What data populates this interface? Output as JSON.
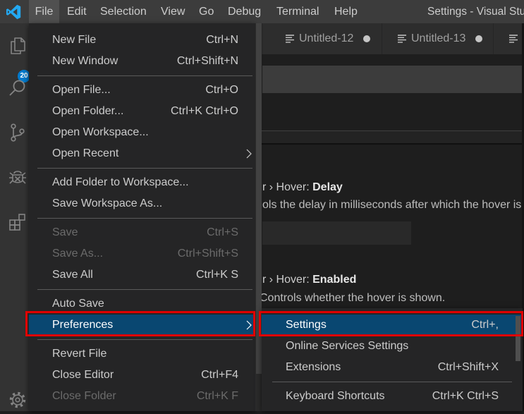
{
  "window": {
    "title": "Settings - Visual Stu"
  },
  "menubar": {
    "items": [
      {
        "label": "File",
        "active": true
      },
      {
        "label": "Edit"
      },
      {
        "label": "Selection"
      },
      {
        "label": "View"
      },
      {
        "label": "Go"
      },
      {
        "label": "Debug"
      },
      {
        "label": "Terminal"
      },
      {
        "label": "Help"
      }
    ]
  },
  "activity_bar": {
    "items": [
      {
        "icon": "files-icon",
        "badge": "20"
      },
      {
        "icon": "search-icon"
      },
      {
        "icon": "source-control-icon"
      },
      {
        "icon": "debug-icon"
      },
      {
        "icon": "extensions-icon"
      }
    ],
    "bottom": [
      {
        "icon": "gear-icon"
      }
    ]
  },
  "tabs": [
    {
      "label": "Untitled-12",
      "dirty": true
    },
    {
      "label": "Untitled-13",
      "dirty": true
    },
    {
      "label": "",
      "dirty": false
    }
  ],
  "settings": {
    "items": [
      {
        "prefix": "r › Hover: ",
        "name": "Delay",
        "description": "ols the delay in milliseconds after which the hover is",
        "value": ""
      },
      {
        "prefix": "r › Hover: ",
        "name": "Enabled",
        "description": "Controls whether the hover is shown."
      }
    ]
  },
  "file_menu": {
    "groups": [
      [
        {
          "label": "New File",
          "shortcut": "Ctrl+N"
        },
        {
          "label": "New Window",
          "shortcut": "Ctrl+Shift+N"
        }
      ],
      [
        {
          "label": "Open File...",
          "shortcut": "Ctrl+O"
        },
        {
          "label": "Open Folder...",
          "shortcut": "Ctrl+K Ctrl+O"
        },
        {
          "label": "Open Workspace...",
          "shortcut": ""
        },
        {
          "label": "Open Recent",
          "shortcut": "",
          "submenu": true
        }
      ],
      [
        {
          "label": "Add Folder to Workspace...",
          "shortcut": ""
        },
        {
          "label": "Save Workspace As...",
          "shortcut": ""
        }
      ],
      [
        {
          "label": "Save",
          "shortcut": "Ctrl+S",
          "disabled": true
        },
        {
          "label": "Save As...",
          "shortcut": "Ctrl+Shift+S",
          "disabled": true
        },
        {
          "label": "Save All",
          "shortcut": "Ctrl+K S"
        }
      ],
      [
        {
          "label": "Auto Save",
          "shortcut": ""
        },
        {
          "label": "Preferences",
          "shortcut": "",
          "submenu": true,
          "highlighted": true
        }
      ],
      [
        {
          "label": "Revert File",
          "shortcut": ""
        },
        {
          "label": "Close Editor",
          "shortcut": "Ctrl+F4"
        },
        {
          "label": "Close Folder",
          "shortcut": "Ctrl+K F",
          "disabled": true
        }
      ]
    ]
  },
  "preferences_menu": {
    "groups": [
      [
        {
          "label": "Settings",
          "shortcut": "Ctrl+,",
          "highlighted": true
        },
        {
          "label": "Online Services Settings",
          "shortcut": ""
        },
        {
          "label": "Extensions",
          "shortcut": "Ctrl+Shift+X"
        }
      ],
      [
        {
          "label": "Keyboard Shortcuts",
          "shortcut": "Ctrl+K Ctrl+S"
        }
      ]
    ]
  },
  "colors": {
    "accent": "#007acc",
    "menu_highlight": "#094771",
    "annotation": "#e00000",
    "logo": "#23a9f2"
  }
}
